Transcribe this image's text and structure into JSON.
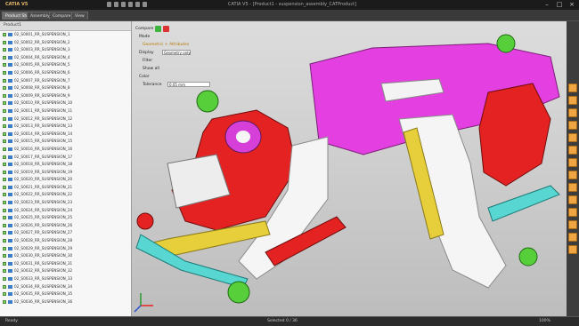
{
  "app": {
    "name": "CATIA V5",
    "document_title": "CATIA V5 - [Product1 - suspension_assembly_CATProduct]"
  },
  "tabs": [
    {
      "label": "Product Structure",
      "active": true
    },
    {
      "label": "Assembly Design",
      "active": false
    },
    {
      "label": "Compare",
      "active": false
    },
    {
      "label": "View",
      "active": false
    }
  ],
  "tree": {
    "header": "Product1",
    "items": [
      "02_S0001_RR_SUSPENSION_1",
      "02_S0002_RR_SUSPENSION_2",
      "02_S0003_RR_SUSPENSION_3",
      "02_S0004_RR_SUSPENSION_4",
      "02_S0005_RR_SUSPENSION_5",
      "02_S0006_RR_SUSPENSION_6",
      "02_S0007_RR_SUSPENSION_7",
      "02_S0008_RR_SUSPENSION_8",
      "02_S0009_RR_SUSPENSION_9",
      "02_S0010_RR_SUSPENSION_10",
      "02_S0011_RR_SUSPENSION_11",
      "02_S0012_RR_SUSPENSION_12",
      "02_S0013_RR_SUSPENSION_13",
      "02_S0014_RR_SUSPENSION_14",
      "02_S0015_RR_SUSPENSION_15",
      "02_S0016_RR_SUSPENSION_16",
      "02_S0017_RR_SUSPENSION_17",
      "02_S0018_RR_SUSPENSION_18",
      "02_S0019_RR_SUSPENSION_19",
      "02_S0020_RR_SUSPENSION_20",
      "02_S0021_RR_SUSPENSION_21",
      "02_S0022_RR_SUSPENSION_22",
      "02_S0023_RR_SUSPENSION_23",
      "02_S0024_RR_SUSPENSION_24",
      "02_S0025_RR_SUSPENSION_25",
      "02_S0026_RR_SUSPENSION_26",
      "02_S0027_RR_SUSPENSION_27",
      "02_S0028_RR_SUSPENSION_28",
      "02_S0029_RR_SUSPENSION_29",
      "02_S0030_RR_SUSPENSION_30",
      "02_S0031_RR_SUSPENSION_31",
      "02_S0032_RR_SUSPENSION_32",
      "02_S0033_RR_SUSPENSION_33",
      "02_S0034_RR_SUSPENSION_34",
      "02_S0035_RR_SUSPENSION_35",
      "02_S0036_RR_SUSPENSION_36"
    ]
  },
  "overlay": {
    "compare_label": "Compare",
    "mode_label": "Mode",
    "option_label": "Geometric + Attributes",
    "display_label": "Display",
    "display_value": "Geometry only",
    "filter_label": "Filter",
    "checkbox_label": "Show all",
    "color_label": "Color",
    "tolerance_label": "Tolerance",
    "tolerance_value": "0.05 mm"
  },
  "status": {
    "left": "Ready",
    "center": "Selected 0 / 36",
    "right": "100%"
  },
  "colors": {
    "accent": "#f0a642",
    "red_part": "#e52222",
    "magenta_part": "#e43fe0",
    "green_part": "#56cf3a",
    "cyan_part": "#57d6d2",
    "yellow_part": "#e6cf3a"
  }
}
